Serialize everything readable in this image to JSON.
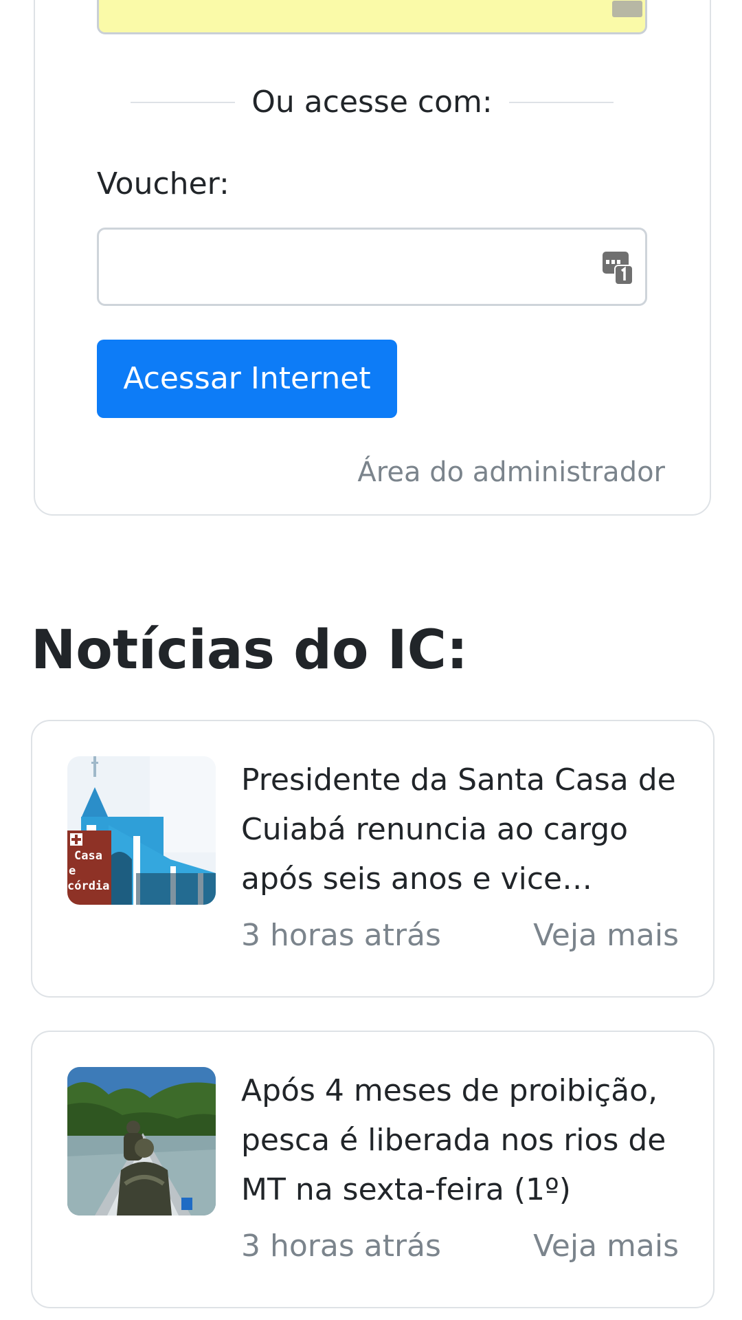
{
  "login": {
    "divider_text": "Ou acesse com:",
    "voucher_label": "Voucher:",
    "voucher_value": "",
    "voucher_placeholder": "",
    "access_button_label": "Acessar Internet",
    "admin_link_label": "Área do administrador"
  },
  "news": {
    "section_title": "Notícias do IC:",
    "items": [
      {
        "headline": "Presidente da Santa Casa de Cuiabá renuncia ao cargo após seis anos e vice assume",
        "thumb_sign_text_1": "Casa",
        "thumb_sign_text_2": "e",
        "thumb_sign_text_3": "córdia",
        "time": "3 horas atrás",
        "more_label": "Veja mais"
      },
      {
        "headline": "Após 4 meses de proibição, pesca é liberada nos rios de MT na sexta-feira (1º)",
        "time": "3 horas atrás",
        "more_label": "Veja mais"
      }
    ]
  },
  "colors": {
    "primary_button": "#0d7cf7",
    "autofill_field": "#fafaa8",
    "muted_text": "#7b848c"
  }
}
